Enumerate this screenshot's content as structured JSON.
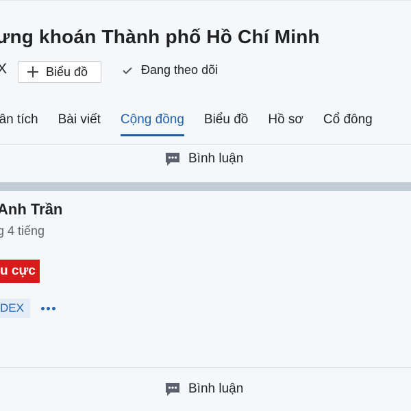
{
  "header": {
    "title": "ưng khoán Thành phố Hồ Chí Minh",
    "ticker_tail": "X",
    "chart_button_label": "Biểu đồ",
    "following_label": "Đang theo dõi"
  },
  "tabs": [
    {
      "label": "hân tích",
      "active": false
    },
    {
      "label": "Bài viết",
      "active": false
    },
    {
      "label": "Cộng đồng",
      "active": true
    },
    {
      "label": "Biểu đồ",
      "active": false
    },
    {
      "label": "Hồ sơ",
      "active": false
    },
    {
      "label": "Cổ đông",
      "active": false
    }
  ],
  "comment_label": "Bình luận",
  "post": {
    "author": "Anh Trần",
    "time": "g 4 tiếng",
    "sentiment_tag": "u cực",
    "ticker": "DEX",
    "comment_label": "Bình luận"
  },
  "colors": {
    "accent": "#1e63b0",
    "negative_tag": "#d71a1a",
    "band": "#c2ccd6",
    "background": "#f6f7f9"
  },
  "icons": {
    "chart_button": "plus-icon",
    "following": "check-icon",
    "comment": "comment-bubble-icon",
    "more": "ellipsis-icon"
  }
}
